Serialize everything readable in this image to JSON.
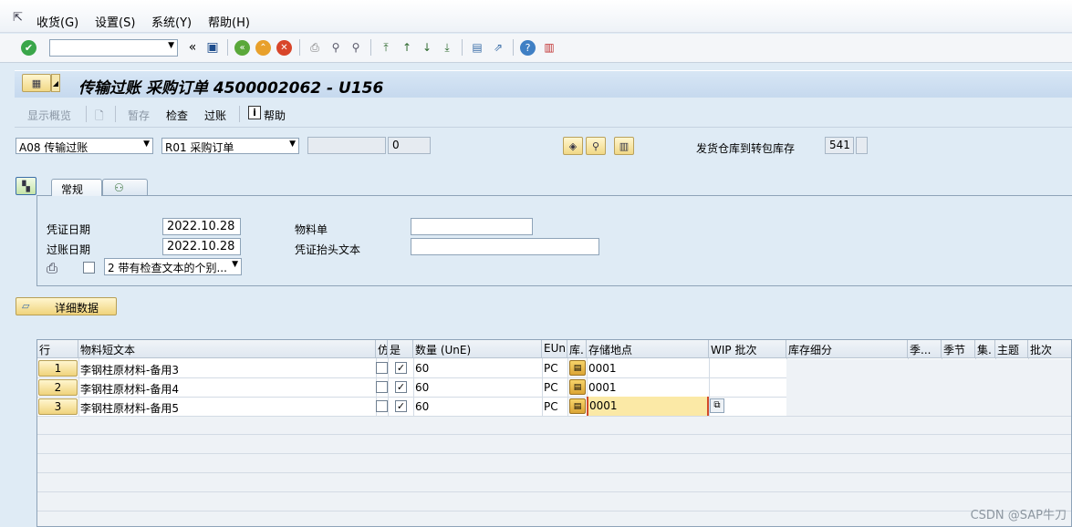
{
  "menu": {
    "items": [
      {
        "label": "收货(G)"
      },
      {
        "label": "设置(S)"
      },
      {
        "label": "系统(Y)"
      },
      {
        "label": "帮助(H)"
      }
    ]
  },
  "toolbar": {
    "command_field_value": "",
    "icons": [
      "check-icon",
      "save-icon",
      "back-icon",
      "exit-icon",
      "cancel-icon",
      "print-icon",
      "find-icon",
      "find-next-icon",
      "first-page-icon",
      "prev-page-icon",
      "next-page-icon",
      "last-page-icon",
      "new-session-icon",
      "shortcut-icon",
      "help-icon",
      "customize-icon"
    ]
  },
  "title": "传输过账 采购订单 4500002062 - U156",
  "app_toolbar": {
    "overview": "显示概览",
    "save": "暂存",
    "check": "检查",
    "post": "过账",
    "help": "帮助"
  },
  "header_fields": {
    "transaction": "A08 传输过账",
    "reference": "R01 采购订单",
    "ref_number": "",
    "ref_count": "0",
    "movement_type_label": "发货仓库到转包库存",
    "movement_type": "541"
  },
  "tabs": [
    "常规"
  ],
  "general": {
    "doc_date_label": "凭证日期",
    "doc_date": "2022.10.28",
    "post_date_label": "过账日期",
    "post_date": "2022.10.28",
    "material_slip_label": "物料单",
    "material_slip": "",
    "header_text_label": "凭证抬头文本",
    "header_text": "",
    "print_option": "2 带有检查文本的个别..."
  },
  "detail_button": "详细数据",
  "grid": {
    "headers": [
      "行",
      "物料短文本",
      "仿",
      "是",
      "数量 (UnE)",
      "EUn",
      "库.",
      "存储地点",
      "WIP 批次",
      "库存细分",
      "季...",
      "季节",
      "集.",
      "主题",
      "批次"
    ],
    "rows": [
      {
        "line": "1",
        "text": "李钢柱原材料-备用3",
        "ok": "✓",
        "qty": "60",
        "unit": "PC",
        "sloc": "0001"
      },
      {
        "line": "2",
        "text": "李钢柱原材料-备用4",
        "ok": "✓",
        "qty": "60",
        "unit": "PC",
        "sloc": "0001"
      },
      {
        "line": "3",
        "text": "李钢柱原材料-备用5",
        "ok": "✓",
        "qty": "60",
        "unit": "PC",
        "sloc": "0001"
      }
    ]
  },
  "watermark": "CSDN @SAP牛刀"
}
